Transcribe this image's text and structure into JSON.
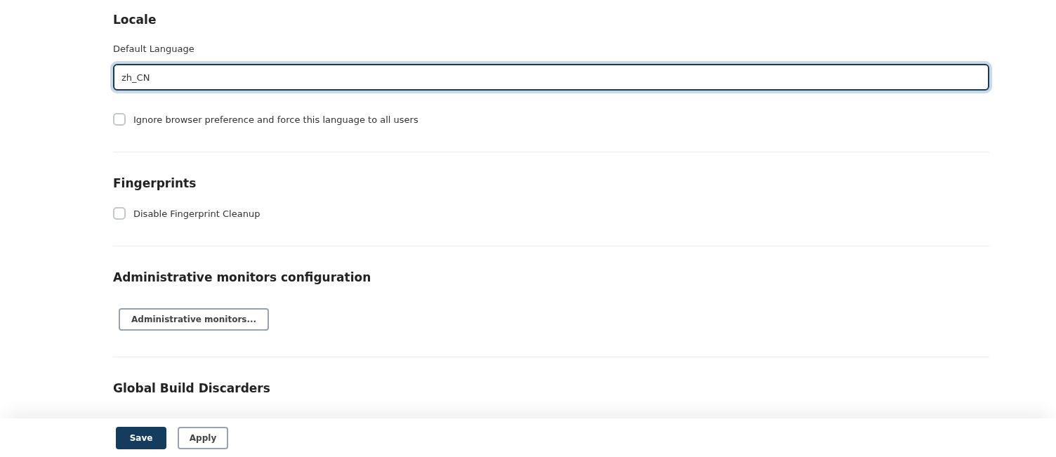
{
  "sections": [
    {
      "heading": "Locale",
      "items": [
        {
          "kind": "field",
          "label": "Default Language",
          "value": "zh_CN",
          "focused": true
        },
        {
          "kind": "checkbox",
          "label": "Ignore browser preference and force this language to all users",
          "checked": false
        }
      ]
    },
    {
      "heading": "Fingerprints",
      "items": [
        {
          "kind": "checkbox",
          "label": "Disable Fingerprint Cleanup",
          "checked": false
        }
      ]
    },
    {
      "heading": "Administrative monitors configuration",
      "items": [
        {
          "kind": "button",
          "label": "Administrative monitors..."
        }
      ]
    },
    {
      "heading": "Global Build Discarders"
    }
  ],
  "bottom_bar": {
    "buttons": [
      {
        "label": "Save",
        "kind": "primary"
      },
      {
        "label": "Apply",
        "kind": "secondary"
      }
    ]
  }
}
